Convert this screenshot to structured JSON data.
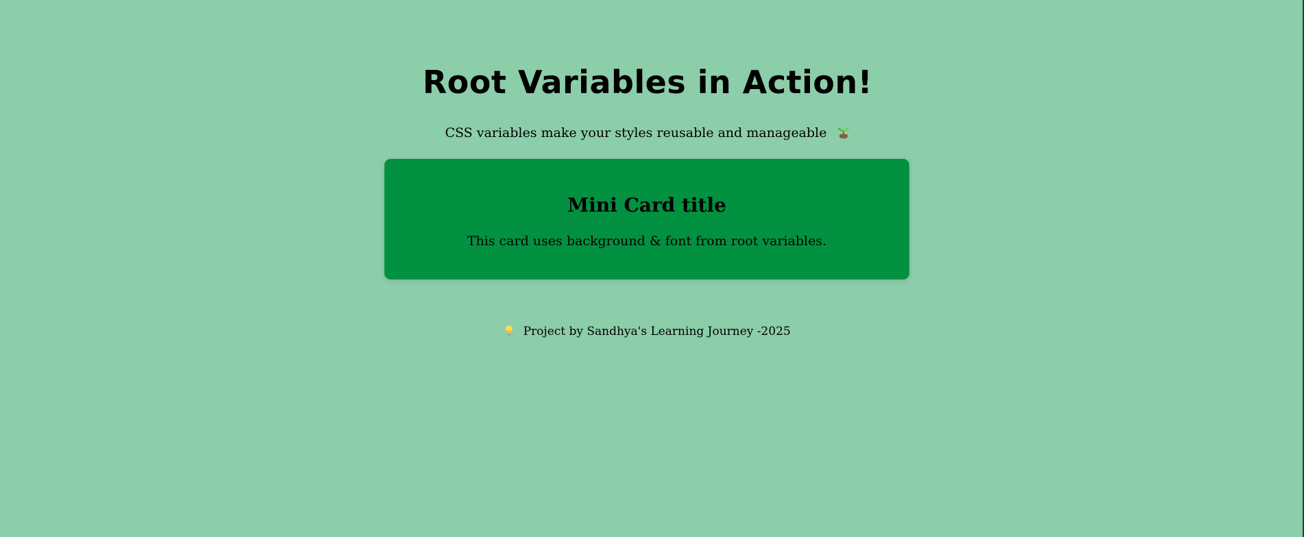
{
  "page": {
    "title": "Root Variables in Action!",
    "subtitle": "CSS variables make your styles reusable and manageable",
    "subtitle_icon": "sprout-icon"
  },
  "card": {
    "title": "Mini Card title",
    "text": "This card uses background & font from root variables."
  },
  "footer": {
    "icon": "lightbulb-icon",
    "text": "Project by Sandhya's Learning Journey -2025"
  },
  "colors": {
    "background": "#8ccdaa",
    "card": "#029141",
    "text": "#000000"
  }
}
